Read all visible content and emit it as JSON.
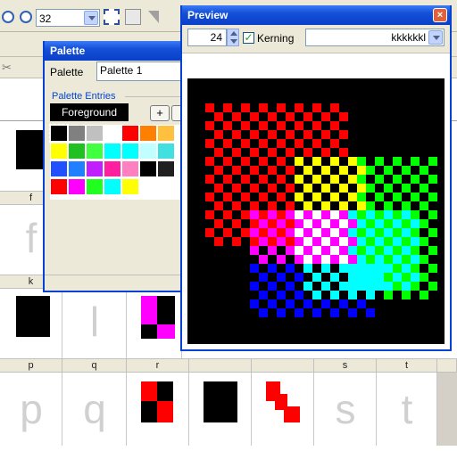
{
  "main": {
    "zoom_value": "32",
    "column_headers": [
      "f",
      "k",
      "p",
      "q",
      "r",
      "s",
      "t"
    ],
    "glyph_letters": [
      "f",
      "l",
      "p",
      "q",
      "s",
      "t"
    ]
  },
  "palette_window": {
    "title": "Palette",
    "palette_label": "Palette",
    "palette_name": "Palette 1",
    "entries_label": "Palette Entries",
    "foreground_label": "Foreground",
    "add_button": "+",
    "colors": [
      "#000000",
      "#808080",
      "#c0c0c0",
      "#ffffff",
      "#ff0000",
      "#ff8000",
      "#ffc040",
      "#ffff00",
      "#20c020",
      "#40ff40",
      "#00ffff",
      "#00ffff",
      "#c0ffff",
      "#40e0e0",
      "#2050ff",
      "#2080ff",
      "#c020ff",
      "#ff20a0",
      "#ff80c0",
      "#000000",
      "#202020",
      "#ff0000",
      "#ff00ff",
      "#20ff20",
      "#00ffff",
      "#ffff00",
      "#ffffff"
    ]
  },
  "preview_window": {
    "title": "Preview",
    "close_label": "×",
    "size_value": "24",
    "kerning_label": "Kerning",
    "kerning_checked": true,
    "preview_text": "kkkkkkl"
  }
}
